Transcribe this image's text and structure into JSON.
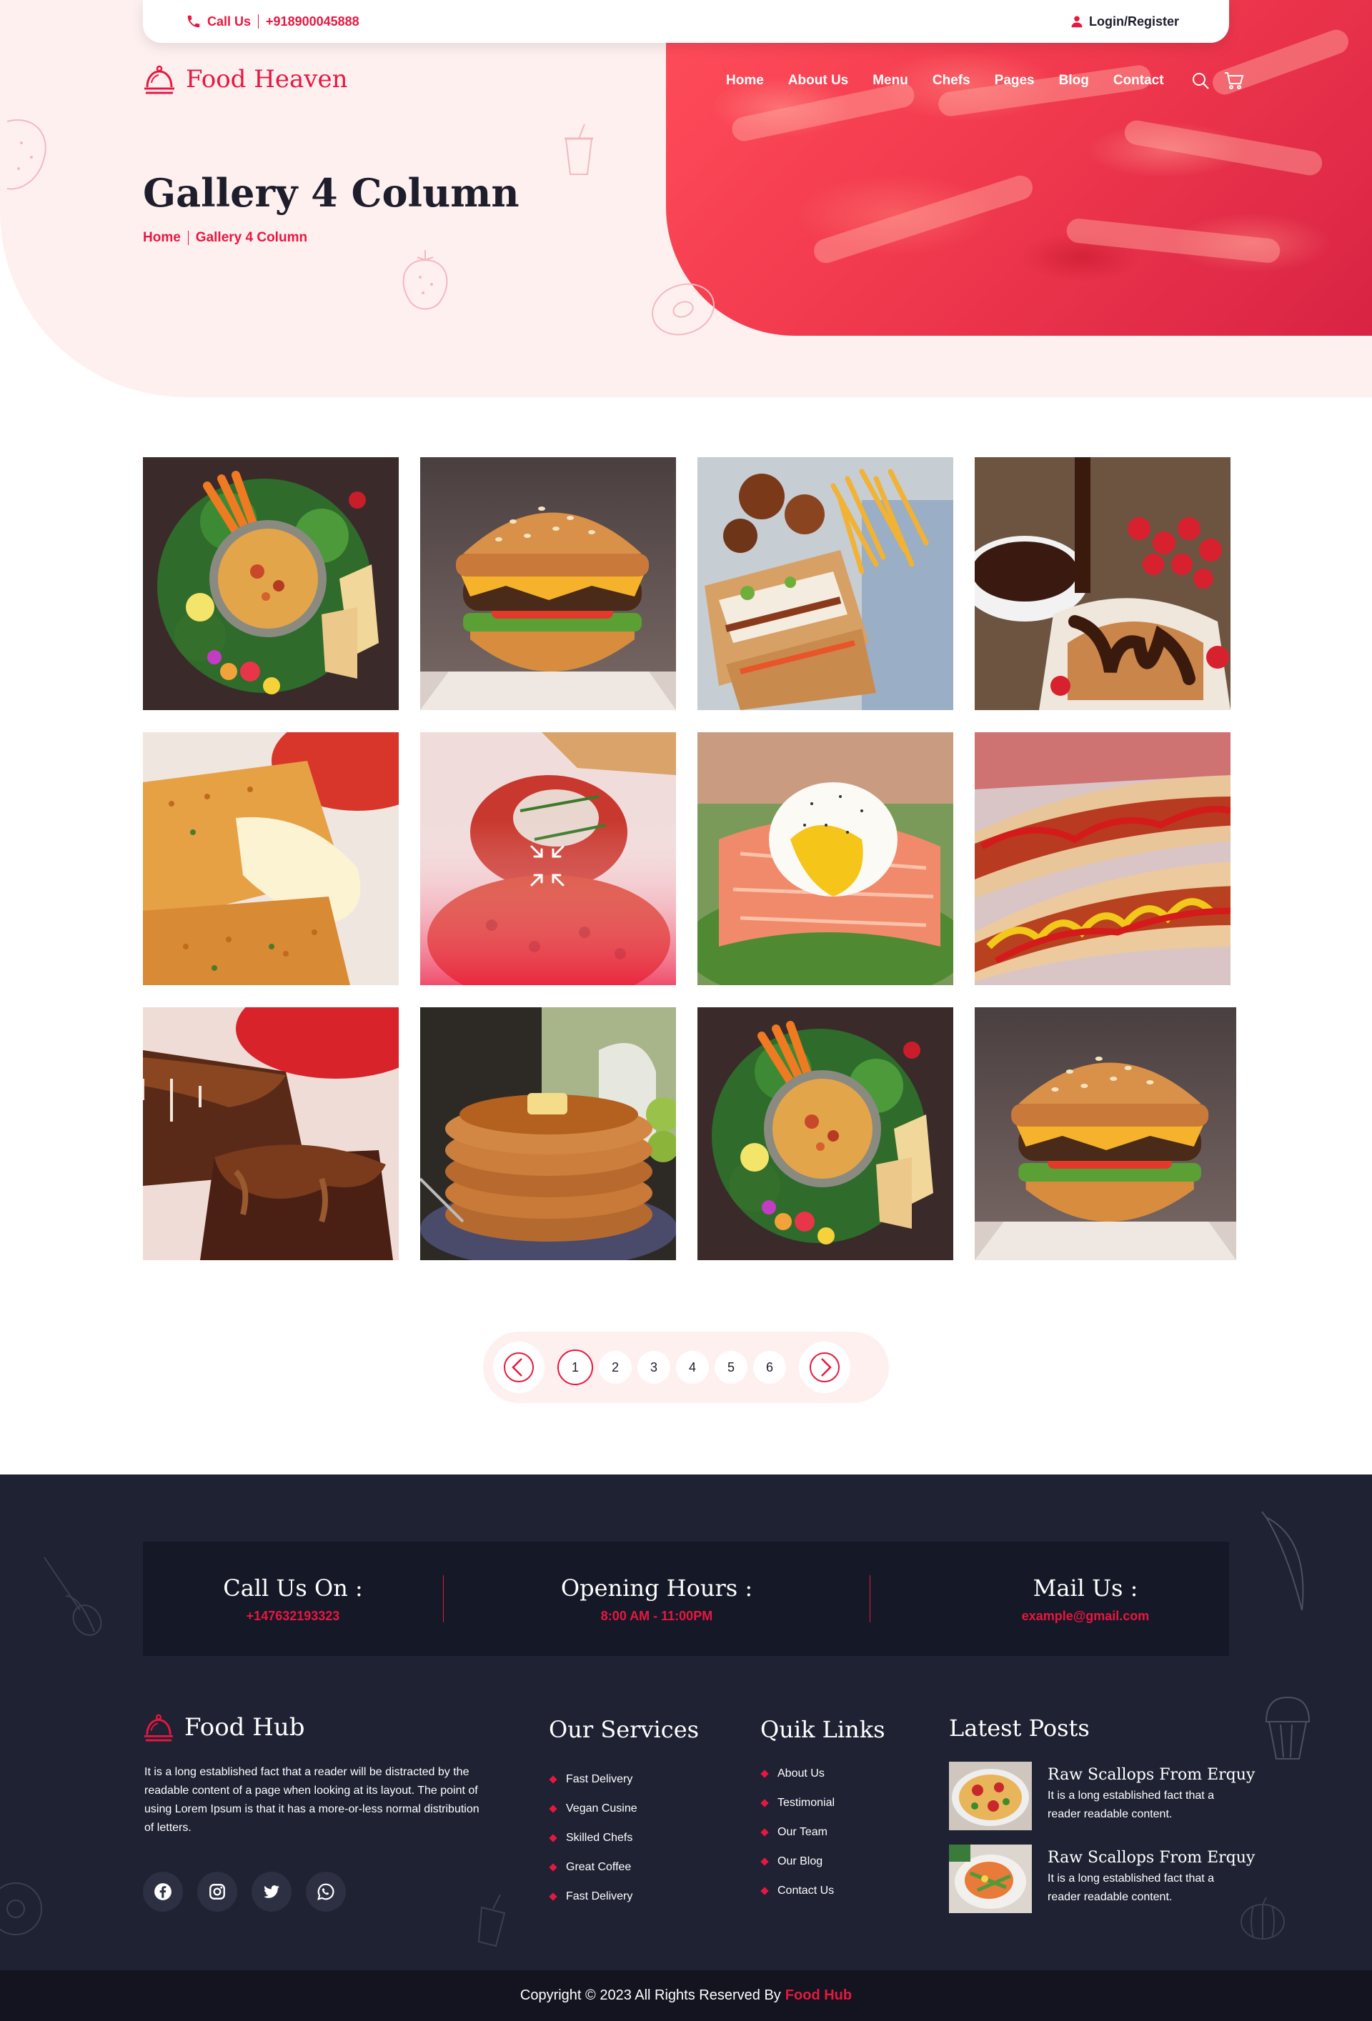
{
  "topbar": {
    "call_label": "Call Us",
    "phone": "+918900045888",
    "login_label": "Login/Register"
  },
  "brand": {
    "name": "Food Heaven"
  },
  "nav": {
    "items": [
      "Home",
      "About Us",
      "Menu",
      "Chefs",
      "Pages",
      "Blog",
      "Contact"
    ],
    "icons": [
      "search-icon",
      "cart-icon"
    ]
  },
  "hero": {
    "title": "Gallery 4 Column",
    "breadcrumb": [
      "Home",
      "Gallery 4 Column"
    ]
  },
  "gallery": {
    "columns": 4,
    "images": [
      "hummus-platter",
      "cheeseburger",
      "chicken-wrap-with-fries",
      "chocolate-dessert",
      "mozzarella-sticks",
      "stuffed-tomato",
      "poached-egg-salmon",
      "hot-dogs",
      "chocolate-brownie",
      "pancake-stack",
      "hummus-platter",
      "cheeseburger"
    ],
    "hover_icon": "expand-arrows-icon"
  },
  "pagination": {
    "pages": [
      "1",
      "2",
      "3",
      "4",
      "5",
      "6"
    ],
    "current": "1",
    "prev_icon": "chevron-left-icon",
    "next_icon": "chevron-right-icon"
  },
  "footer": {
    "contact": [
      {
        "title": "Call Us On :",
        "value": "+147632193323"
      },
      {
        "title": "Opening Hours :",
        "value": "8:00 AM - 11:00PM"
      },
      {
        "title": "Mail Us :",
        "value": "example@gmail.com"
      }
    ],
    "brand_name": "Food Hub",
    "about": "It is a long established fact that a reader will be distracted by the readable content of a page when looking at its layout. The point of using Lorem Ipsum is that it has a more-or-less normal distribution of letters.",
    "socials": [
      "facebook-icon",
      "instagram-icon",
      "twitter-icon",
      "whatsapp-icon"
    ],
    "services": {
      "title": "Our Services",
      "items": [
        "Fast Delivery",
        "Vegan Cusine",
        "Skilled Chefs",
        "Great Coffee",
        "Fast Delivery"
      ]
    },
    "links": {
      "title": "Quik Links",
      "items": [
        "About Us",
        "Testimonial",
        "Our Team",
        "Our Blog",
        "Contact Us"
      ]
    },
    "posts": {
      "title": "Latest Posts",
      "items": [
        {
          "title": "Raw Scallops From Erquy",
          "desc": "It is a long established fact that a reader readable content."
        },
        {
          "title": "Raw Scallops From Erquy",
          "desc": "It is a long established fact that a reader readable content."
        }
      ]
    },
    "copyright": "Copyright © 2023 All Rights Reserved By",
    "copyright_brand": "Food Hub"
  },
  "colors": {
    "accent": "#e8173f",
    "hero_bg": "#fff0f0",
    "footer_bg": "#1e2233",
    "footer_box": "#151827",
    "copyright_bg": "#13141f"
  }
}
